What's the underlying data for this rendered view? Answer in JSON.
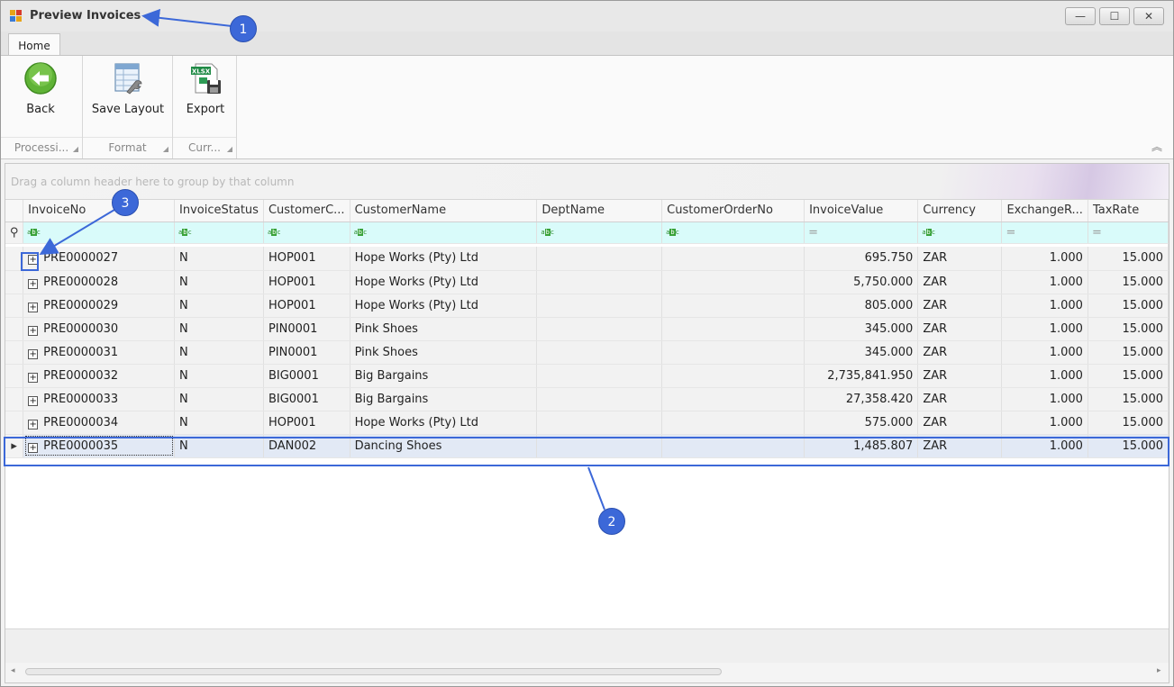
{
  "window": {
    "title": "Preview Invoices",
    "controls": {
      "minimize": "—",
      "maximize": "☐",
      "close": "✕"
    }
  },
  "ribbon": {
    "tab": "Home",
    "groups": [
      {
        "button": "Back",
        "caption": "Processi...",
        "icon": "back-arrow-icon"
      },
      {
        "button": "Save Layout",
        "caption": "Format",
        "icon": "save-layout-icon"
      },
      {
        "button": "Export",
        "caption": "Curr...",
        "icon": "xlsx-export-icon"
      }
    ]
  },
  "grid": {
    "group_panel_hint": "Drag a column header here to group by that column",
    "columns": [
      "InvoiceNo",
      "InvoiceStatus",
      "CustomerC...",
      "CustomerName",
      "DeptName",
      "CustomerOrderNo",
      "InvoiceValue",
      "Currency",
      "ExchangeR...",
      "TaxRate"
    ],
    "filter_types": [
      "abc",
      "abc",
      "abc",
      "abc",
      "abc",
      "abc",
      "=",
      "abc",
      "=",
      "="
    ],
    "filter_glyph": {
      "left": "a",
      "mid": "b",
      "right": "c",
      "eq": "="
    },
    "rows": [
      [
        "PRE0000027",
        "N",
        "HOP001",
        "Hope Works (Pty) Ltd",
        "",
        "",
        "695.750",
        "ZAR",
        "1.000",
        "15.000"
      ],
      [
        "PRE0000028",
        "N",
        "HOP001",
        "Hope Works (Pty) Ltd",
        "",
        "",
        "5,750.000",
        "ZAR",
        "1.000",
        "15.000"
      ],
      [
        "PRE0000029",
        "N",
        "HOP001",
        "Hope Works (Pty) Ltd",
        "",
        "",
        "805.000",
        "ZAR",
        "1.000",
        "15.000"
      ],
      [
        "PRE0000030",
        "N",
        "PIN0001",
        "Pink Shoes",
        "",
        "",
        "345.000",
        "ZAR",
        "1.000",
        "15.000"
      ],
      [
        "PRE0000031",
        "N",
        "PIN0001",
        "Pink Shoes",
        "",
        "",
        "345.000",
        "ZAR",
        "1.000",
        "15.000"
      ],
      [
        "PRE0000032",
        "N",
        "BIG0001",
        "Big Bargains",
        "",
        "",
        "2,735,841.950",
        "ZAR",
        "1.000",
        "15.000"
      ],
      [
        "PRE0000033",
        "N",
        "BIG0001",
        "Big Bargains",
        "",
        "",
        "27,358.420",
        "ZAR",
        "1.000",
        "15.000"
      ],
      [
        "PRE0000034",
        "N",
        "HOP001",
        "Hope Works (Pty) Ltd",
        "",
        "",
        "575.000",
        "ZAR",
        "1.000",
        "15.000"
      ],
      [
        "PRE0000035",
        "N",
        "DAN002",
        "Dancing Shoes",
        "",
        "",
        "1,485.807",
        "ZAR",
        "1.000",
        "15.000"
      ]
    ],
    "selected_row": 8,
    "expander_glyph": "+",
    "row_indicator": "▸",
    "filter_row_icon": "⚲"
  },
  "annotations": [
    "1",
    "2",
    "3"
  ],
  "colors": {
    "accent": "#3c68d8",
    "filter_row": "#d9fbfa",
    "selected_row": "#e2e9f5"
  }
}
